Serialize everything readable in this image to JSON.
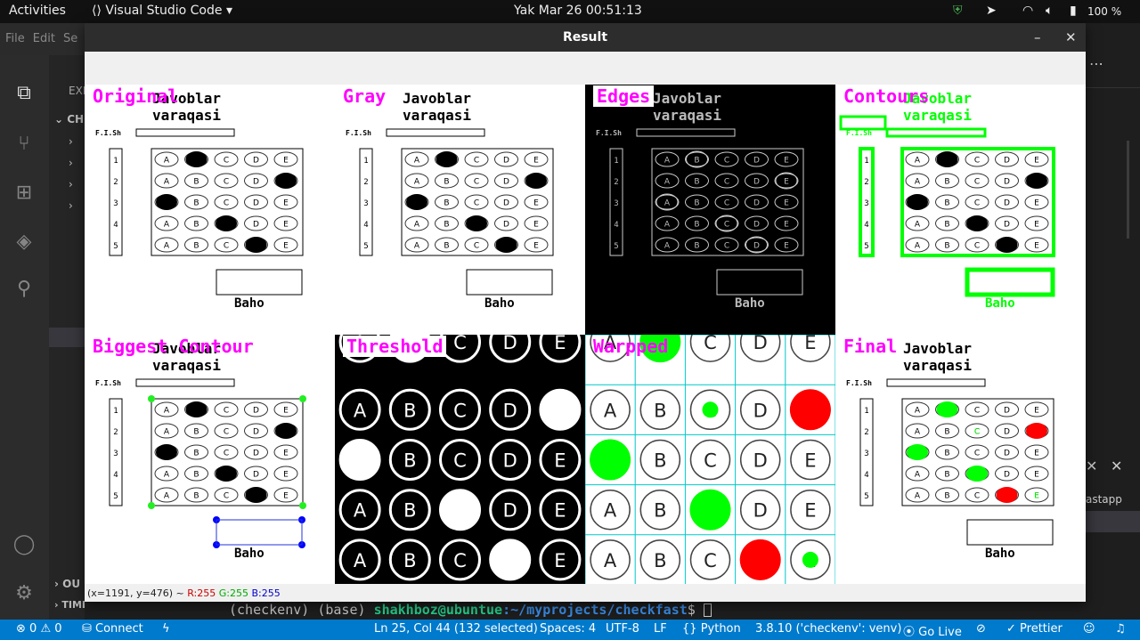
{
  "topbar": {
    "activities": "Activities",
    "app": "Visual Studio Code",
    "clock": "Yak Mar 26  00:51:13",
    "battery": "100 %"
  },
  "menubar": [
    "File",
    "Edit",
    "Se"
  ],
  "sidebar": {
    "explorer": "EXI",
    "folder": "CH",
    "outline": "OU",
    "timeline": "TIMELINE"
  },
  "right_pane": {
    "text": "astapp"
  },
  "terminal": {
    "prompt": "(checkenv) (base) ",
    "user": "shakhboz@ubuntue",
    "path": ":~/myprojects/checkfast",
    "symbol": "$"
  },
  "statusbar": {
    "errors": "0",
    "warnings": "0",
    "connect": "Connect",
    "position": "Ln 25, Col 44 (132 selected)",
    "spaces": "Spaces: 4",
    "encoding": "UTF-8",
    "eol": "LF",
    "language": "Python",
    "interpreter": "3.8.10 ('checkenv': venv)",
    "golive": "Go Live",
    "prettier": "Prettier"
  },
  "window": {
    "title": "Result",
    "status": {
      "coords": "(x=1191, y=476) ~ ",
      "r": "R:255",
      "g": "G:255",
      "b": "B:255"
    },
    "panels": [
      {
        "label": "Original"
      },
      {
        "label": "Gray"
      },
      {
        "label": "Edges"
      },
      {
        "label": "Contours"
      },
      {
        "label": "Biggest Contour"
      },
      {
        "label": "Threshold"
      },
      {
        "label": "Warpped"
      },
      {
        "label": "Final"
      }
    ],
    "sheet": {
      "title1": "Javoblar",
      "title2": "varaqasi",
      "fish": "F.I.Sh",
      "baho": "Baho",
      "rows": [
        "1",
        "2",
        "3",
        "4",
        "5"
      ],
      "options": [
        "A",
        "B",
        "C",
        "D",
        "E"
      ]
    }
  },
  "colors": {
    "label": "#ff00ff",
    "contour": "#00ff00",
    "grid": "#00c8c8",
    "correct": "#00ff00",
    "wrong": "#ff0000",
    "status_bar": "#007acc"
  }
}
